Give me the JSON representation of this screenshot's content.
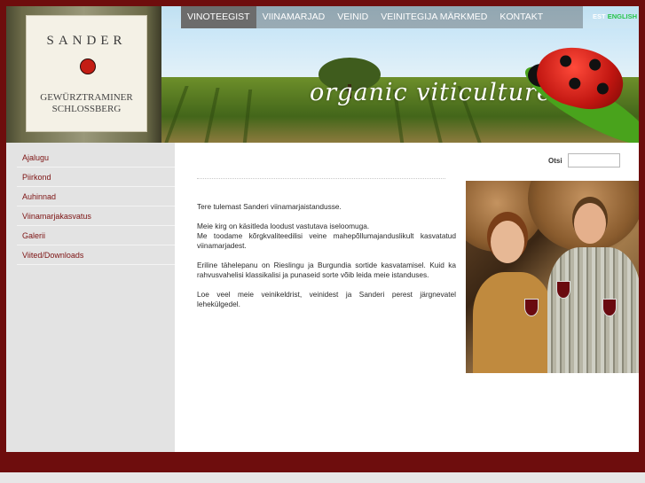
{
  "brand": {
    "bottle_producer": "SANDER",
    "bottle_variety": "GEWÜRZTRAMINER",
    "bottle_vineyard": "SCHLOSSBERG",
    "slogan": "organic viticulture"
  },
  "nav": {
    "items": [
      {
        "label": "VINOTEEGIST",
        "active": true
      },
      {
        "label": "VIINAMARJAD"
      },
      {
        "label": "VEINID"
      },
      {
        "label": "VEINITEGIJA MÄRKMED"
      },
      {
        "label": "KONTAKT"
      }
    ]
  },
  "lang": {
    "est": "EST",
    "eng": "ENGLISH"
  },
  "sidebar": {
    "items": [
      {
        "label": "Ajalugu"
      },
      {
        "label": "Piirkond"
      },
      {
        "label": "Auhinnad"
      },
      {
        "label": "Viinamarjakasvatus"
      },
      {
        "label": "Galerii"
      },
      {
        "label": "Viited/Downloads"
      }
    ]
  },
  "search": {
    "label": "Otsi",
    "value": ""
  },
  "content": {
    "p1": "Tere tulemast Sanderi viinamarjaistandusse.",
    "p2a": "Meie kirg on käsitleda loodust vastutava iseloomuga.",
    "p2b": "Me toodame kõrgkvaliteedilisi veine mahepõllumajanduslikult kasvatatud viinamarjadest.",
    "p3": "Eriline tähelepanu on Rieslingu ja Burgundia sortide kasvatamisel. Kuid ka rahvusvahelisi klassikalisi ja punaseid sorte võib leida meie istanduses.",
    "p4": "Loe veel meie veinikeldrist, veinidest ja Sanderi perest järgnevatel lehekülgedel."
  },
  "colors": {
    "frame": "#6e0d0d",
    "nav_active": "#6c6c6c",
    "sidebar_bg": "#e3e3e3",
    "sidebar_link": "#7c1212",
    "lang_eng": "#27c44a"
  }
}
